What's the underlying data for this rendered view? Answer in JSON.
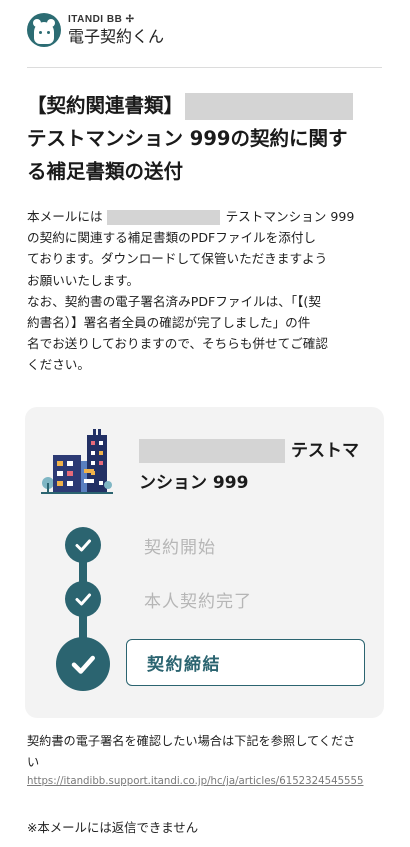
{
  "header": {
    "brand": "ITANDI BB ✢",
    "product": "電子契約くん"
  },
  "title": {
    "prefix": "【契約関連書類】",
    "line2": "テストマンション 999の契約に関す",
    "line3": "る補足書類の送付"
  },
  "body": {
    "l1_prefix": "本メールには",
    "l1_suffix": "テストマンション 999",
    "l2": "の契約に関連する補足書類のPDFファイルを添付し",
    "l3": "ております。ダウンロードして保管いただきますよう",
    "l4": "お願いいたします。",
    "l5": "なお、契約書の電子署名済みPDFファイルは、「【(契",
    "l6": "約書名）】署名者全員の確認が完了しました」の件",
    "l7": "名でお送りしておりますので、そちらも併せてご確認",
    "l8": "ください。"
  },
  "card": {
    "property_suffix": "テストマ",
    "property_line2": "ンション 999",
    "steps": [
      {
        "label": "契約開始",
        "state": "done"
      },
      {
        "label": "本人契約完了",
        "state": "done"
      },
      {
        "label": "契約締結",
        "state": "current"
      }
    ]
  },
  "note": {
    "text": "契約書の電子署名を確認したい場合は下記を参照してくださ",
    "text2": "い",
    "link": "https://itandibb.support.itandi.co.jp/hc/ja/articles/6152324545555"
  },
  "footer": "※本メールには返信できません",
  "colors": {
    "accent": "#2b6470",
    "card_bg": "#f3f3f3",
    "redaction": "#d4d4d4",
    "muted": "#b6b6b6"
  }
}
